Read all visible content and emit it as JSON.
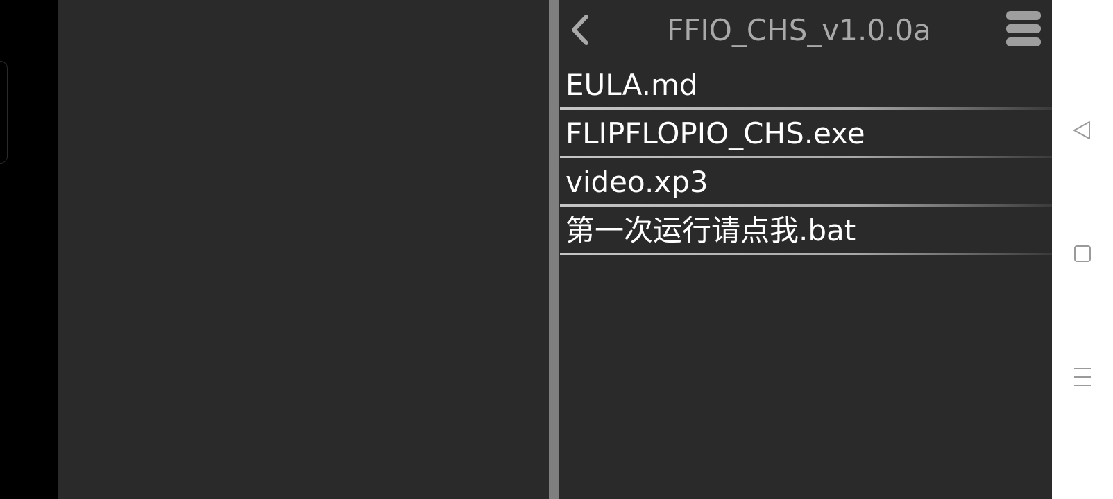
{
  "file_browser": {
    "title": "FFIO_CHS_v1.0.0a",
    "back_icon": "chevron-left-icon",
    "menu_icon": "hamburger-menu-icon",
    "files": [
      "EULA.md",
      "FLIPFLOPIO_CHS.exe",
      "video.xp3",
      "第一次运行请点我.bat"
    ]
  },
  "system_nav": {
    "icons": [
      "back-triangle-icon",
      "home-square-icon",
      "recents-menu-icon"
    ]
  },
  "colors": {
    "app_background": "#2a2a2a",
    "divider": "#7f7f7f",
    "title_text": "#a9a9a9",
    "file_text": "#ffffff",
    "nav_bar": "#ffffff",
    "nav_icon": "#9a9a9a"
  }
}
